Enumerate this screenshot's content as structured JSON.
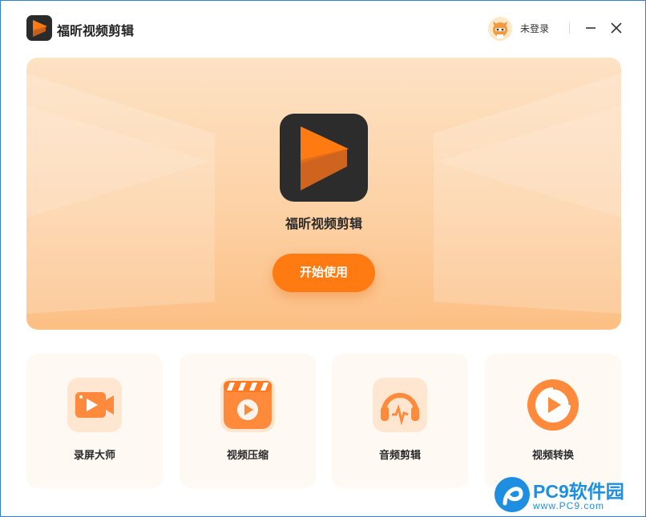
{
  "app": {
    "title": "福昕视频剪辑",
    "accent": "#ff7a10"
  },
  "header": {
    "login_text": "未登录",
    "minimize_icon": "minimize-icon",
    "close_icon": "close-icon"
  },
  "banner": {
    "title": "福昕视频剪辑",
    "start_button": "开始使用"
  },
  "features": [
    {
      "label": "录屏大师",
      "icon": "screen-record-icon"
    },
    {
      "label": "视频压缩",
      "icon": "video-compress-icon"
    },
    {
      "label": "音频剪辑",
      "icon": "audio-edit-icon"
    },
    {
      "label": "视频转换",
      "icon": "video-convert-icon"
    }
  ],
  "watermark": {
    "brand": "PC9软件园",
    "url": "www.PC9.com"
  }
}
